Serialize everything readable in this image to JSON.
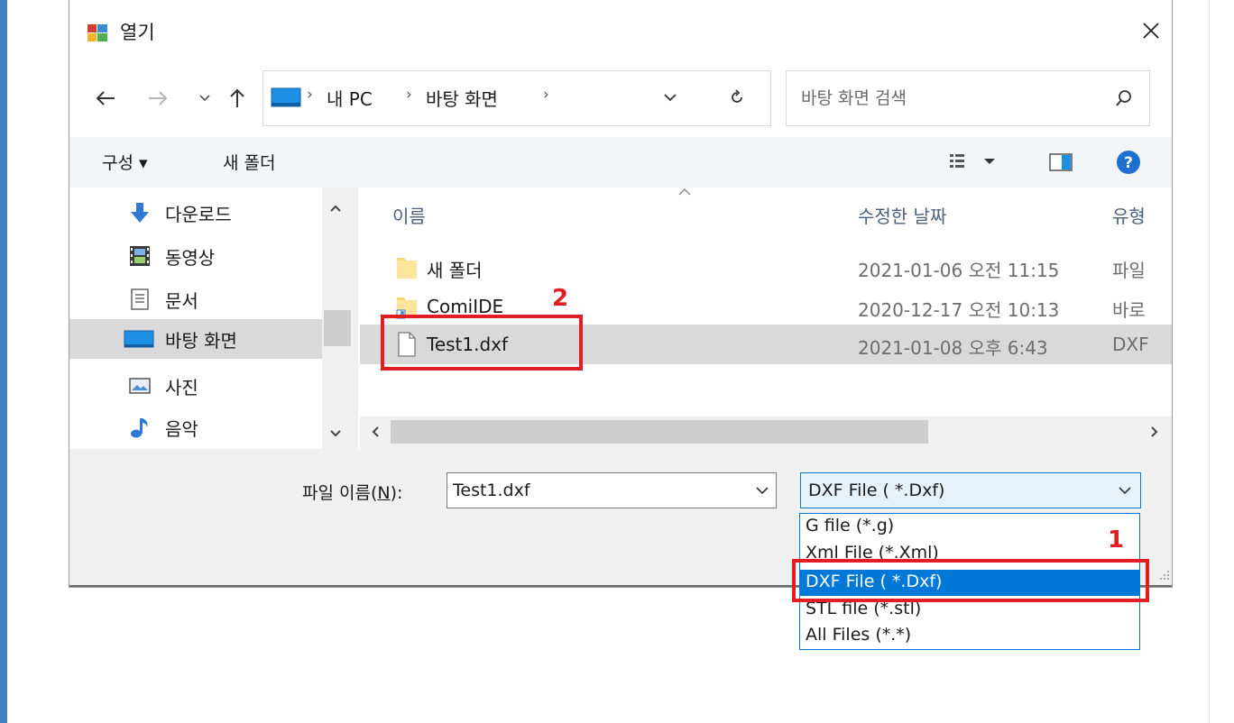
{
  "dialog": {
    "title": "열기",
    "icons": {
      "app": "dialog-app-icon",
      "close": "close-icon"
    }
  },
  "navigation": {
    "breadcrumb": [
      "내 PC",
      "바탕 화면"
    ],
    "search_placeholder": "바탕 화면 검색",
    "icons": {
      "back": "arrow-left-icon",
      "forward": "arrow-right-icon",
      "recent": "chevron-down-icon",
      "up": "arrow-up-icon",
      "refresh": "refresh-icon",
      "search": "search-icon"
    }
  },
  "toolbar": {
    "organize_label": "구성 ▾",
    "new_folder_label": "새 폴더"
  },
  "nav_pane": {
    "items": [
      {
        "label": "다운로드",
        "icon": "download-icon"
      },
      {
        "label": "동영상",
        "icon": "video-icon"
      },
      {
        "label": "문서",
        "icon": "document-icon"
      },
      {
        "label": "바탕 화면",
        "icon": "desktop-icon",
        "selected": true
      },
      {
        "label": "사진",
        "icon": "pictures-icon"
      },
      {
        "label": "음악",
        "icon": "music-icon"
      }
    ]
  },
  "file_list": {
    "columns": {
      "name": "이름",
      "date": "수정한 날짜",
      "type": "유형"
    },
    "rows": [
      {
        "name": "새 폴더",
        "date": "2021-01-06 오전 11:15",
        "type": "파일",
        "icon": "folder-icon"
      },
      {
        "name": "ComiIDE",
        "date": "2020-12-17 오전 10:13",
        "type": "바로",
        "icon": "folder-shortcut-icon"
      },
      {
        "name": "Test1.dxf",
        "date": "2021-01-08 오후 6:43",
        "type": "DXF",
        "icon": "file-icon",
        "selected": true
      }
    ]
  },
  "bottom": {
    "filename_label_pre": "파일 이름(",
    "filename_label_key": "N",
    "filename_label_post": "):",
    "filename_value": "Test1.dxf",
    "filetype_selected": "DXF File  ( *.Dxf)",
    "filetype_options": [
      "G file (*.g)",
      "Xml File  (*.Xml)",
      "DXF File  ( *.Dxf)",
      "STL file (*.stl)",
      "All Files  (*.*)"
    ]
  },
  "annotations": {
    "badge_1": "1",
    "badge_2": "2"
  },
  "colors": {
    "accent": "#0078d7",
    "annotation": "#e21e25",
    "selection": "#d9d9d9",
    "left_bar": "#3f7fc1"
  }
}
